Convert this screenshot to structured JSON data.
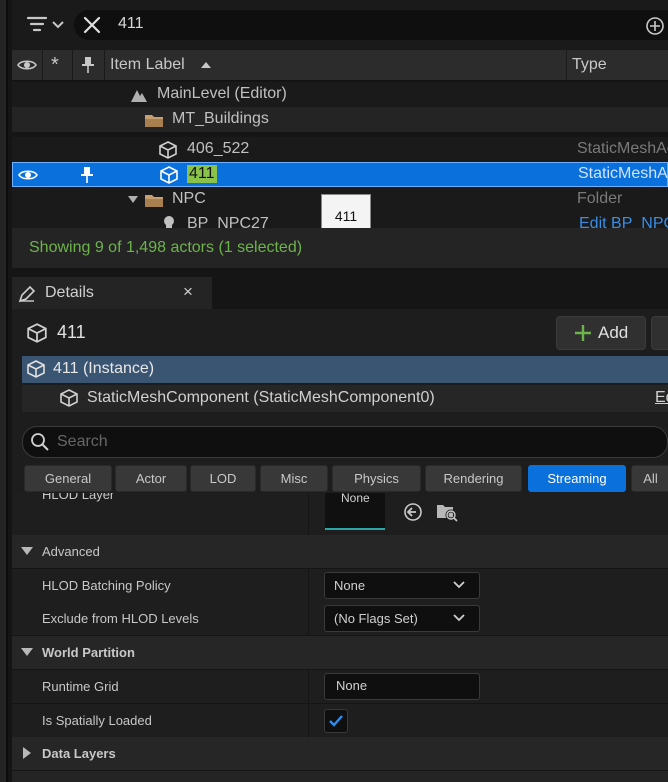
{
  "outliner": {
    "search_value": "411",
    "columns": {
      "label": "Item Label",
      "type": "Type"
    },
    "rows": [
      {
        "label": "MainLevel (Editor)",
        "type": ""
      },
      {
        "label": "MT_Buildings",
        "type": ""
      },
      {
        "label": "406_522",
        "type": "StaticMeshActor"
      },
      {
        "label": "411",
        "type": "StaticMeshActor"
      },
      {
        "label": "NPC",
        "type": "Folder"
      },
      {
        "label": "BP_NPC27",
        "type": "Edit BP_NPC"
      }
    ],
    "tooltip": "411",
    "status": "Showing 9 of 1,498 actors (1 selected)"
  },
  "details": {
    "tab_title": "Details",
    "actor_name": "411",
    "add_label": "Add",
    "components": [
      {
        "label": "411 (Instance)"
      },
      {
        "label": "StaticMeshComponent (StaticMeshComponent0)",
        "extra": "Ed"
      }
    ],
    "search_placeholder": "Search",
    "filters": [
      "General",
      "Actor",
      "LOD",
      "Misc",
      "Physics",
      "Rendering",
      "Streaming",
      "All"
    ],
    "active_filter": "Streaming",
    "hlod_layer": {
      "label": "HLOD Layer",
      "value": "None"
    },
    "sections": {
      "advanced": "Advanced",
      "world_partition": "World Partition",
      "data_layers": "Data Layers"
    },
    "properties": {
      "hlod_batching_policy": {
        "label": "HLOD Batching Policy",
        "value": "None"
      },
      "exclude_hlod": {
        "label": "Exclude from HLOD Levels",
        "value": "(No Flags Set)"
      },
      "runtime_grid": {
        "label": "Runtime Grid",
        "value": "None"
      },
      "spatially_loaded": {
        "label": "Is Spatially Loaded",
        "checked": true
      }
    }
  },
  "colors": {
    "selection": "#0a70dc",
    "status_text": "#6db34b",
    "component_highlight": "#3a5572"
  }
}
